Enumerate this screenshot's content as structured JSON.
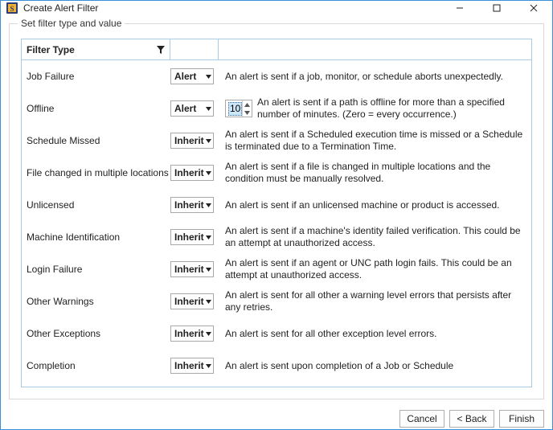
{
  "window": {
    "title": "Create Alert Filter"
  },
  "groupbox": {
    "legend": "Set filter type and value"
  },
  "grid": {
    "headers": {
      "filter_type": "Filter Type",
      "value": "",
      "description": ""
    },
    "rows": [
      {
        "label": "Job Failure",
        "value": "Alert",
        "desc": "An alert is sent if a job, monitor, or schedule aborts unexpectedly."
      },
      {
        "label": "Offline",
        "value": "Alert",
        "has_spinner": true,
        "spinner_value": "10",
        "desc": "An alert is sent if a path is offline for more than a specified number of minutes. (Zero = every occurrence.)"
      },
      {
        "label": "Schedule Missed",
        "value": "Inherit",
        "desc": "An alert is sent if a Scheduled execution time is missed or a Schedule is terminated due to a Termination Time."
      },
      {
        "label": "File changed in multiple locations",
        "value": "Inherit",
        "desc": "An alert is sent if a file is changed in multiple locations and the condition must be manually resolved."
      },
      {
        "label": "Unlicensed",
        "value": "Inherit",
        "desc": "An alert is sent if an unlicensed machine or product is accessed."
      },
      {
        "label": "Machine Identification",
        "value": "Inherit",
        "desc": "An alert is sent if a machine's identity failed verification. This could be an attempt at unauthorized access."
      },
      {
        "label": "Login Failure",
        "value": "Inherit",
        "desc": "An alert is sent if an agent or UNC path login fails. This could be an attempt at unauthorized access."
      },
      {
        "label": "Other Warnings",
        "value": "Inherit",
        "desc": "An alert is sent for all other a warning level errors that persists after any retries."
      },
      {
        "label": "Other Exceptions",
        "value": "Inherit",
        "desc": "An alert is sent for all other exception level errors."
      },
      {
        "label": "Completion",
        "value": "Inherit",
        "desc": "An alert is sent upon completion of a Job or Schedule"
      }
    ]
  },
  "footer": {
    "cancel": "Cancel",
    "back": "< Back",
    "finish": "Finish"
  }
}
